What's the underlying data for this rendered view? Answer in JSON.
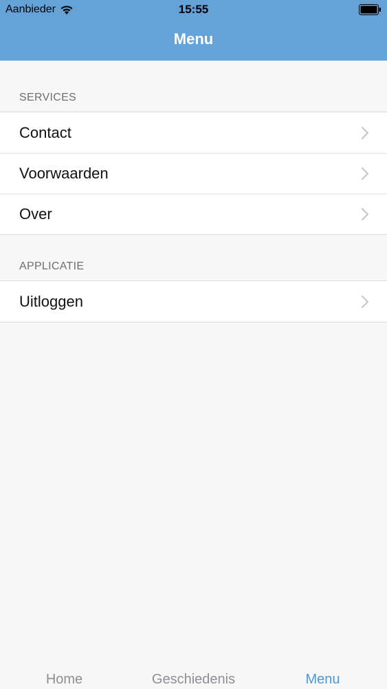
{
  "status_bar": {
    "carrier": "Aanbieder",
    "time": "15:55",
    "wifi_icon": "wifi-icon",
    "battery_icon": "battery-icon"
  },
  "nav": {
    "title": "Menu",
    "background_color": "#64a2d8"
  },
  "sections": [
    {
      "header": "SERVICES",
      "items": [
        {
          "label": "Contact",
          "icon": "chevron-right-icon"
        },
        {
          "label": "Voorwaarden",
          "icon": "chevron-right-icon"
        },
        {
          "label": "Over",
          "icon": "chevron-right-icon"
        }
      ]
    },
    {
      "header": "APPLICATIE",
      "items": [
        {
          "label": "Uitloggen",
          "icon": "chevron-right-icon"
        }
      ]
    }
  ],
  "tab_bar": {
    "tabs": [
      {
        "label": "Home",
        "selected": false
      },
      {
        "label": "Geschiedenis",
        "selected": false
      },
      {
        "label": "Menu",
        "selected": true
      }
    ],
    "selected_color": "#4b98d6",
    "unselected_color": "#8e8e93"
  }
}
